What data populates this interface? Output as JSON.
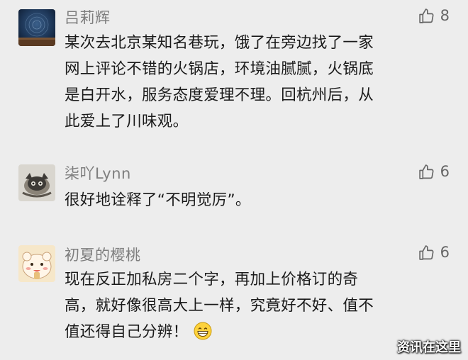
{
  "comments": [
    {
      "author": "吕莉辉",
      "likes": "8",
      "lines": [
        "某次去北京某知名巷玩，饿了在旁边找了一家",
        "网上评论不错的火锅店，环境油腻腻，火锅底",
        "是白开水，服务态度爱理不理。回杭州后，从",
        "此爱上了川味观。"
      ]
    },
    {
      "author": "柒吖Lynn",
      "likes": "6",
      "lines": [
        "很好地诠释了“不明觉厉”。"
      ]
    },
    {
      "author": "初夏的樱桃",
      "likes": "6",
      "lines": [
        "现在反正加私房二个字，再加上价格订的奇",
        "高，就好像很高大上一样，究竟好不好、值不",
        "值还得自己分辨！"
      ]
    }
  ],
  "icons": {
    "like": "thumbs-up-outline-icon",
    "emoji": "grinning-face-icon"
  },
  "watermark": "资讯在这里",
  "colors": {
    "background": "#ededed",
    "name": "#7e7e7e",
    "text": "#1a1a1a",
    "like_icon": "#666666"
  }
}
